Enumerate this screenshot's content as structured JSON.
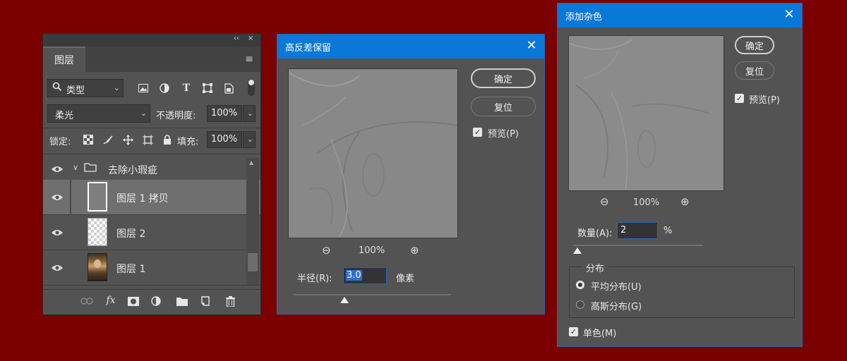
{
  "colors": {
    "background": "#7b0000",
    "titlebar": "#0a78d7",
    "panel": "#535353"
  },
  "layers_panel": {
    "collapse_glyph": "‹‹",
    "close_glyph": "×",
    "tab_label": "图层",
    "menu_glyph": "≡",
    "filter_type": "类型",
    "filter_icons": [
      "image-filter-icon",
      "adjustment-filter-icon",
      "type-filter-icon",
      "shape-filter-icon",
      "smart-object-filter-icon"
    ],
    "blend_mode": "柔光",
    "opacity_label": "不透明度:",
    "opacity_value": "100%",
    "lock_label": "锁定:",
    "fill_label": "填充:",
    "fill_value": "100%",
    "layers": [
      {
        "name": "去除小瑕疵",
        "type": "group"
      },
      {
        "name": "图层 1 拷贝",
        "type": "layer",
        "selected": true
      },
      {
        "name": "图层 2",
        "type": "layer"
      },
      {
        "name": "图层 1",
        "type": "layer"
      }
    ],
    "footer_icons": [
      "link-icon",
      "fx-icon",
      "mask-icon",
      "adjustment-layer-icon",
      "folder-icon",
      "new-layer-icon",
      "trash-icon"
    ]
  },
  "high_pass_dialog": {
    "title": "高反差保留",
    "close_glyph": "✕",
    "ok_label": "确定",
    "reset_label": "复位",
    "preview_label": "预览(P)",
    "preview_checked": true,
    "zoom_level": "100%",
    "radius_label": "半径(R):",
    "radius_value": "3.0",
    "radius_unit": "像素",
    "slider_fraction": 0.16
  },
  "add_noise_dialog": {
    "title": "添加杂色",
    "close_glyph": "✕",
    "ok_label": "确定",
    "reset_label": "复位",
    "preview_label": "预览(P)",
    "preview_checked": true,
    "zoom_level": "100%",
    "amount_label": "数量(A):",
    "amount_value": "2",
    "amount_unit": "%",
    "slider_fraction": 0.0,
    "distribution_label": "分布",
    "uniform_label": "平均分布(U)",
    "gaussian_label": "高斯分布(G)",
    "uniform_selected": true,
    "monochromatic_label": "单色(M)",
    "monochromatic_checked": true
  }
}
